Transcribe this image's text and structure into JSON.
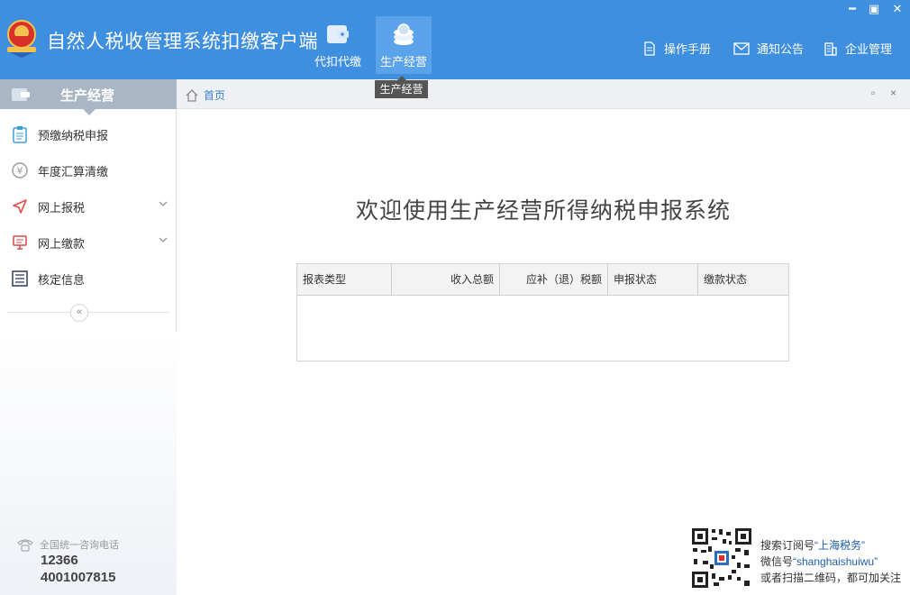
{
  "header": {
    "title": "自然人税收管理系统扣缴客户端",
    "tabs": [
      {
        "label": "代扣代缴",
        "icon": "wallet-icon"
      },
      {
        "label": "生产经营",
        "icon": "coin-stack-icon"
      }
    ],
    "tooltip": "生产经营",
    "links": [
      {
        "label": "操作手册",
        "icon": "document-icon"
      },
      {
        "label": "通知公告",
        "icon": "envelope-icon"
      },
      {
        "label": "企业管理",
        "icon": "building-icon"
      }
    ],
    "window_controls": {
      "minimize": "━",
      "maximize": "▣",
      "close": "✕"
    }
  },
  "sidebar": {
    "title": "生产经营",
    "items": [
      {
        "label": "预缴纳税申报",
        "icon": "clipboard-icon"
      },
      {
        "label": "年度汇算清缴",
        "icon": "yen-icon"
      },
      {
        "label": "网上报税",
        "icon": "send-icon"
      },
      {
        "label": "网上缴款",
        "icon": "monitor-icon"
      },
      {
        "label": "核定信息",
        "icon": "list-icon"
      }
    ],
    "collapse": "«",
    "hotline_label": "全国统一咨询电话",
    "hotline_numbers": [
      "12366",
      "4001007815"
    ]
  },
  "breadcrumb": {
    "home": "首页",
    "restore": "▫",
    "close": "×"
  },
  "main": {
    "welcome": "欢迎使用生产经营所得纳税申报系统",
    "table": {
      "headers": [
        "报表类型",
        "收入总额",
        "应补（退）税额",
        "申报状态",
        "缴款状态"
      ]
    }
  },
  "footer": {
    "line1_prefix": "搜索订阅号",
    "line1_name": "“上海税务”",
    "line2_prefix": "微信号",
    "line2_name": "“shanghaishuiwu”",
    "line3": "或者扫描二维码，都可加关注"
  },
  "colors": {
    "header_bg": "#3f8fe0",
    "active_tab": "#5aa3ea",
    "sidebar_head": "#a9b6c3",
    "link_blue": "#3a7fc8"
  }
}
